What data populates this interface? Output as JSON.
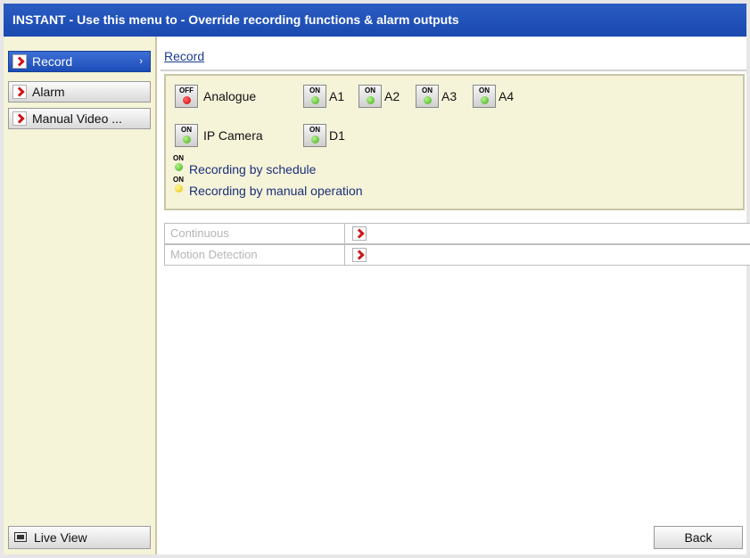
{
  "window": {
    "title": "INSTANT - Use this menu to - Override recording functions & alarm outputs"
  },
  "sidebar": {
    "items": [
      {
        "label": "Record",
        "active": true,
        "arrow": "›"
      },
      {
        "label": "Alarm",
        "active": false
      },
      {
        "label": "Manual Video ...",
        "active": false
      }
    ],
    "live_view_label": "Live View"
  },
  "main": {
    "breadcrumb": "Record",
    "toggles": {
      "analogue": {
        "state": "OFF",
        "label": "Analogue",
        "led": "red"
      },
      "a1": {
        "state": "ON",
        "label": "A1",
        "led": "green"
      },
      "a2": {
        "state": "ON",
        "label": "A2",
        "led": "green"
      },
      "a3": {
        "state": "ON",
        "label": "A3",
        "led": "green"
      },
      "a4": {
        "state": "ON",
        "label": "A4",
        "led": "green"
      },
      "ipcamera": {
        "state": "ON",
        "label": "IP Camera",
        "led": "green"
      },
      "d1": {
        "state": "ON",
        "label": "D1",
        "led": "green"
      }
    },
    "legend": [
      {
        "state": "ON",
        "text": "Recording by schedule",
        "led": "green"
      },
      {
        "state": "ON",
        "text": "Recording by manual operation",
        "led": "yellow"
      }
    ],
    "rows": [
      {
        "label": "Continuous"
      },
      {
        "label": "Motion Detection"
      }
    ],
    "back_label": "Back"
  },
  "colors": {
    "titlebar": "#1a49b0",
    "panel": "#f5f3d8",
    "accent_red": "#d0161b"
  }
}
